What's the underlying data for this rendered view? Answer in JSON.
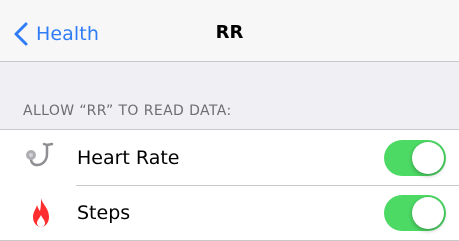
{
  "navbar": {
    "back_label": "Health",
    "title": "RR"
  },
  "section": {
    "header": "ALLOW “RR” TO READ DATA:"
  },
  "items": [
    {
      "label": "Heart Rate",
      "icon": "stethoscope-icon",
      "enabled": true
    },
    {
      "label": "Steps",
      "icon": "flame-icon",
      "enabled": true
    }
  ],
  "colors": {
    "accent": "#2f7cf6",
    "toggle_on": "#4cd964",
    "flame": "#ff2d2d",
    "stethoscope": "#8e8e93",
    "background": "#efeff4"
  }
}
